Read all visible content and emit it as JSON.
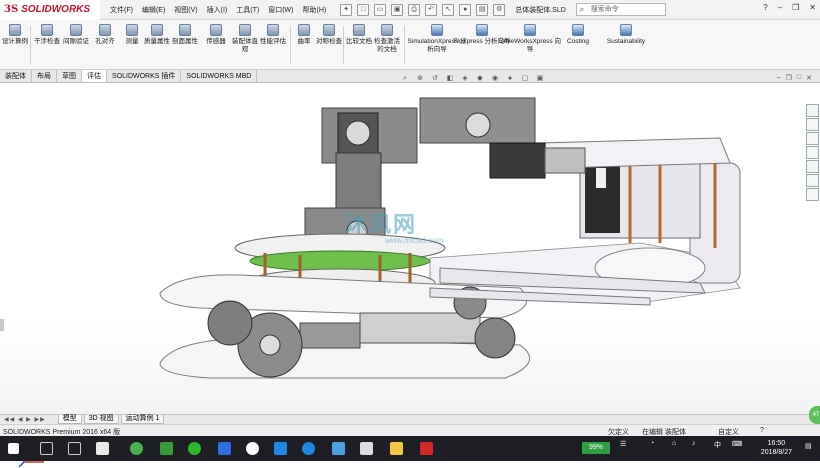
{
  "app": {
    "logo_ds": "3S",
    "logo_name": "SOLIDWORKS",
    "document_title": "总体装配体.SLD",
    "search_placeholder": "搜索命令"
  },
  "menu": [
    "文件(F)",
    "编辑(E)",
    "视图(V)",
    "插入(I)",
    "工具(T)",
    "窗口(W)",
    "帮助(H)"
  ],
  "toolbar": {
    "tools": [
      {
        "label": "设计算例"
      },
      {
        "label": "干涉检查"
      },
      {
        "label": "间隙验证"
      },
      {
        "label": "孔对齐"
      },
      {
        "label": "测量"
      },
      {
        "label": "质量属性"
      },
      {
        "label": "剖面属性"
      },
      {
        "label": "传感器"
      },
      {
        "label": "装配体直观"
      },
      {
        "label": "性能评估"
      },
      {
        "label": "曲率"
      },
      {
        "label": "对称检查"
      },
      {
        "label": "比较文档"
      },
      {
        "label": "检查激活的文档"
      },
      {
        "label": "SimulationXpress 分析向导"
      },
      {
        "label": "FloXpress 分析向导"
      },
      {
        "label": "DriveWorksXpress 向导"
      },
      {
        "label": "Costing"
      },
      {
        "label": "Sustainability"
      }
    ]
  },
  "command_tabs": [
    "装配体",
    "布局",
    "草图",
    "评估",
    "SOLIDWORKS 插件",
    "SOLIDWORKS MBD"
  ],
  "active_tab": "评估",
  "watermark": {
    "text": "沐风网",
    "url": "www.mfcad.com"
  },
  "sheet_tabs": [
    "模型",
    "3D 视图",
    "运动算例 1"
  ],
  "status": {
    "product": "SOLIDWORKS Premium 2016 x64 版",
    "state1": "欠定义",
    "state2": "在编辑 装配体",
    "state3": "自定义",
    "help": "?"
  },
  "taskbar": {
    "battery": "99%",
    "lang": "中",
    "time": "16:50",
    "date": "2018/8/27"
  },
  "fab_label": "47"
}
